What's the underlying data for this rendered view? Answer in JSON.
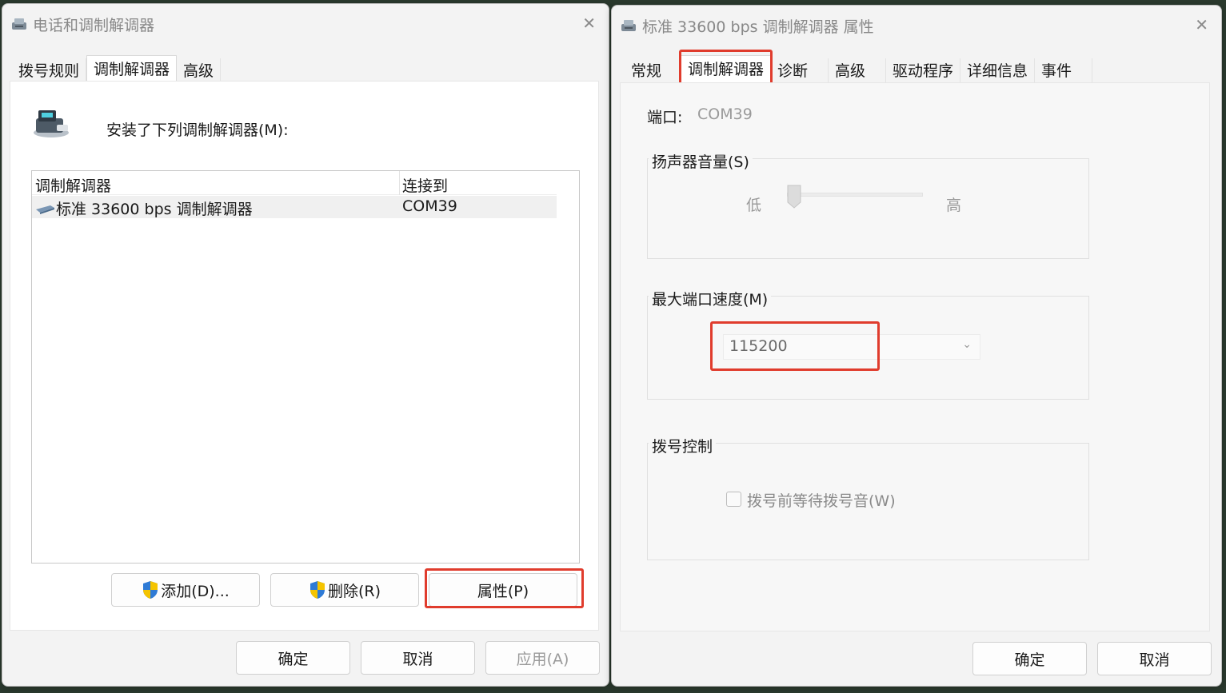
{
  "left_dialog": {
    "title": "电话和调制解调器",
    "tabs": [
      "拨号规则",
      "调制解调器",
      "高级"
    ],
    "active_tab": "调制解调器",
    "installed_label": "安装了下列调制解调器(M):",
    "table": {
      "columns": [
        "调制解调器",
        "连接到"
      ],
      "rows": [
        {
          "name": "标准 33600 bps 调制解调器",
          "port": "COM39"
        }
      ]
    },
    "buttons": {
      "add": "添加(D)...",
      "remove": "删除(R)",
      "properties": "属性(P)"
    },
    "footer": {
      "ok": "确定",
      "cancel": "取消",
      "apply": "应用(A)"
    }
  },
  "right_dialog": {
    "title": "标准 33600 bps 调制解调器 属性",
    "tabs": [
      "常规",
      "调制解调器",
      "诊断",
      "高级",
      "驱动程序",
      "详细信息",
      "事件"
    ],
    "active_tab": "调制解调器",
    "port_label": "端口:",
    "port_value": "COM39",
    "speaker_group": {
      "label": "扬声器音量(S)",
      "low": "低",
      "high": "高",
      "level": 0
    },
    "speed_group": {
      "label": "最大端口速度(M)",
      "value": "115200"
    },
    "dial_group": {
      "label": "拨号控制",
      "checkbox_label": "拨号前等待拨号音(W)",
      "checked": false
    },
    "footer": {
      "ok": "确定",
      "cancel": "取消"
    }
  },
  "colors": {
    "highlight": "#e03c2d"
  }
}
